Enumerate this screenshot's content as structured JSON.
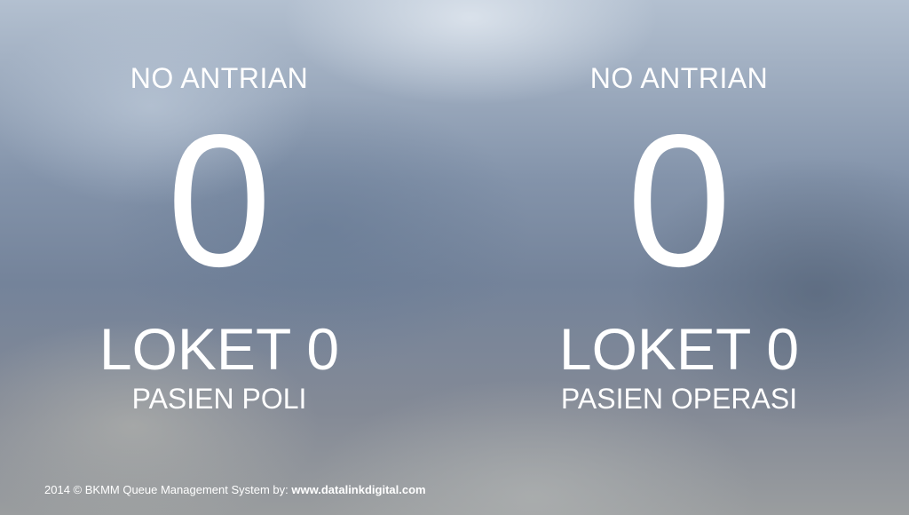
{
  "left_panel": {
    "heading": "NO ANTRIAN",
    "queue_number": "0",
    "counter": "LOKET 0",
    "description": "PASIEN POLI"
  },
  "right_panel": {
    "heading": "NO ANTRIAN",
    "queue_number": "0",
    "counter": "LOKET 0",
    "description": "PASIEN OPERASI"
  },
  "footer": {
    "text": "2014 © BKMM Queue Management System by: ",
    "link": "www.datalinkdigital.com"
  }
}
